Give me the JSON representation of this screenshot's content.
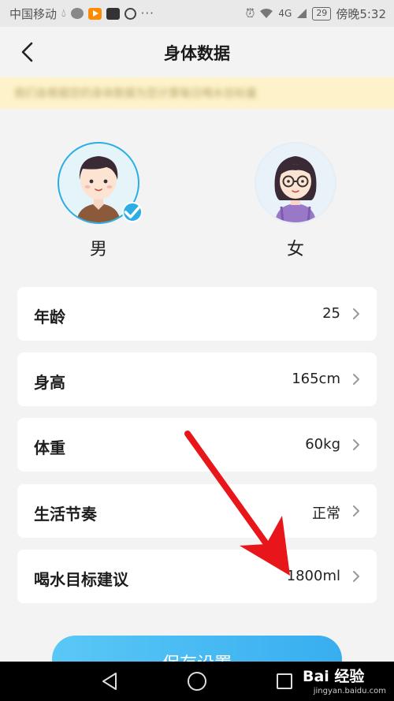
{
  "status_bar": {
    "carrier": "中国移动",
    "network": "4G",
    "battery": "29",
    "time": "傍晚5:32",
    "icons": [
      "drop-icon",
      "chat-icon",
      "video-app-icon",
      "game-app-icon",
      "circle-app-icon",
      "more-dots-icon",
      "alarm-icon",
      "wifi-icon",
      "signal-icon",
      "battery-icon"
    ]
  },
  "header": {
    "title": "身体数据",
    "back_icon": "chevron-left-icon"
  },
  "notice": {
    "text": "我们会根据您的身体数据为您计算每日喝水目标量"
  },
  "gender": {
    "male_label": "男",
    "female_label": "女",
    "selected": "male"
  },
  "rows": [
    {
      "label": "年龄",
      "value": "25"
    },
    {
      "label": "身高",
      "value": "165cm"
    },
    {
      "label": "体重",
      "value": "60kg"
    },
    {
      "label": "生活节奏",
      "value": "正常"
    },
    {
      "label": "喝水目标建议",
      "value": "1800ml"
    }
  ],
  "save_button": {
    "label": "保存设置"
  },
  "watermark": {
    "logo": "Bai 经验",
    "url": "jingyan.baidu.com"
  },
  "colors": {
    "accent": "#2aaee4",
    "notice_bg": "#fdf2c9",
    "arrow": "#e8161b"
  }
}
